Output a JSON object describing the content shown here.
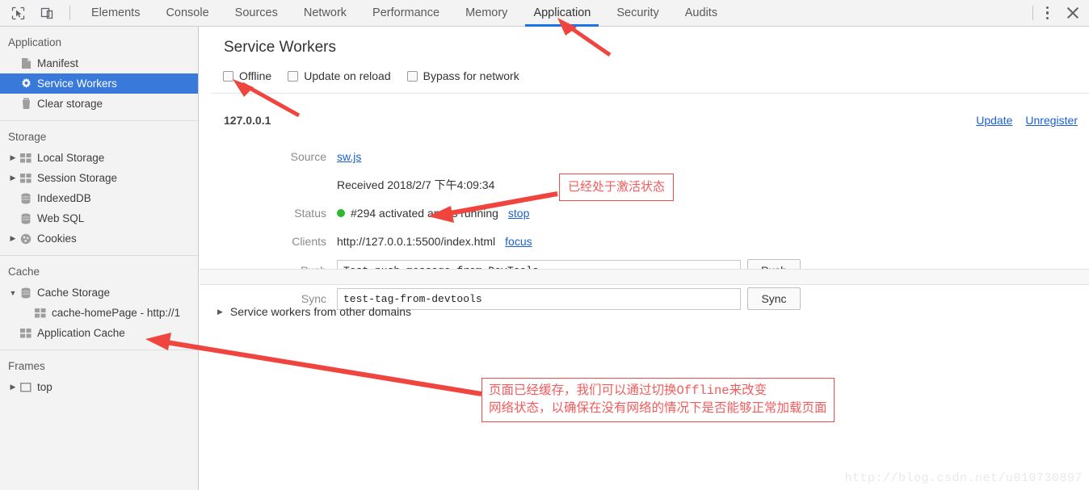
{
  "toolbar": {
    "inspect_icon": "inspect-cursor-icon",
    "device_icon": "device-toolbar-icon",
    "menu_icon": "more-options-icon",
    "close_icon": "close-icon",
    "tabs": [
      {
        "label": "Elements",
        "active": false
      },
      {
        "label": "Console",
        "active": false
      },
      {
        "label": "Sources",
        "active": false
      },
      {
        "label": "Network",
        "active": false
      },
      {
        "label": "Performance",
        "active": false
      },
      {
        "label": "Memory",
        "active": false
      },
      {
        "label": "Application",
        "active": true
      },
      {
        "label": "Security",
        "active": false
      },
      {
        "label": "Audits",
        "active": false
      }
    ]
  },
  "sidebar": {
    "sections": [
      {
        "title": "Application",
        "items": [
          {
            "label": "Manifest",
            "icon": "manifest-file-icon",
            "selected": false,
            "expandable": false
          },
          {
            "label": "Service Workers",
            "icon": "gear-icon",
            "selected": true,
            "expandable": false
          },
          {
            "label": "Clear storage",
            "icon": "trash-icon",
            "selected": false,
            "expandable": false
          }
        ]
      },
      {
        "title": "Storage",
        "items": [
          {
            "label": "Local Storage",
            "icon": "table-icon",
            "selected": false,
            "expandable": true
          },
          {
            "label": "Session Storage",
            "icon": "table-icon",
            "selected": false,
            "expandable": true
          },
          {
            "label": "IndexedDB",
            "icon": "database-icon",
            "selected": false,
            "expandable": false
          },
          {
            "label": "Web SQL",
            "icon": "database-icon",
            "selected": false,
            "expandable": false
          },
          {
            "label": "Cookies",
            "icon": "cookie-icon",
            "selected": false,
            "expandable": true
          }
        ]
      },
      {
        "title": "Cache",
        "items": [
          {
            "label": "Cache Storage",
            "icon": "database-icon",
            "selected": false,
            "expandable": true,
            "expanded": true
          },
          {
            "label": "cache-homePage - http://1",
            "icon": "table-icon",
            "selected": false,
            "expandable": false,
            "child": true
          },
          {
            "label": "Application Cache",
            "icon": "table-icon",
            "selected": false,
            "expandable": false
          }
        ]
      },
      {
        "title": "Frames",
        "items": [
          {
            "label": "top",
            "icon": "frame-icon",
            "selected": false,
            "expandable": true
          }
        ]
      }
    ]
  },
  "main": {
    "title": "Service Workers",
    "checkboxes": [
      {
        "label": "Offline",
        "checked": false
      },
      {
        "label": "Update on reload",
        "checked": false
      },
      {
        "label": "Bypass for network",
        "checked": false
      }
    ],
    "origin": "127.0.0.1",
    "top_actions": [
      {
        "label": "Update"
      },
      {
        "label": "Unregister"
      }
    ],
    "rows": {
      "source_label": "Source",
      "source_link": "sw.js",
      "received": "Received 2018/2/7 下午4:09:34",
      "status_label": "Status",
      "status_text": "#294 activated and is running",
      "status_color": "#2eb82e",
      "stop_link": "stop",
      "clients_label": "Clients",
      "clients_value": "http://127.0.0.1:5500/index.html",
      "focus_link": "focus",
      "push_label": "Push",
      "push_value": "Test push message from DevTools.",
      "push_button": "Push",
      "sync_label": "Sync",
      "sync_value": "test-tag-from-devtools",
      "sync_button": "Sync"
    },
    "other_domains": "Service workers from other domains",
    "watermark": "http://blog.csdn.net/u010730897"
  },
  "annotations": {
    "accent_color": "#ef4b4b",
    "note_status": "已经处于激活状态",
    "note_cache_line1": "页面已经缓存，我们可以通过切换Offline来改变",
    "note_cache_line2": "网络状态，以确保在没有网络的情况下是否能够正常加载页面"
  }
}
